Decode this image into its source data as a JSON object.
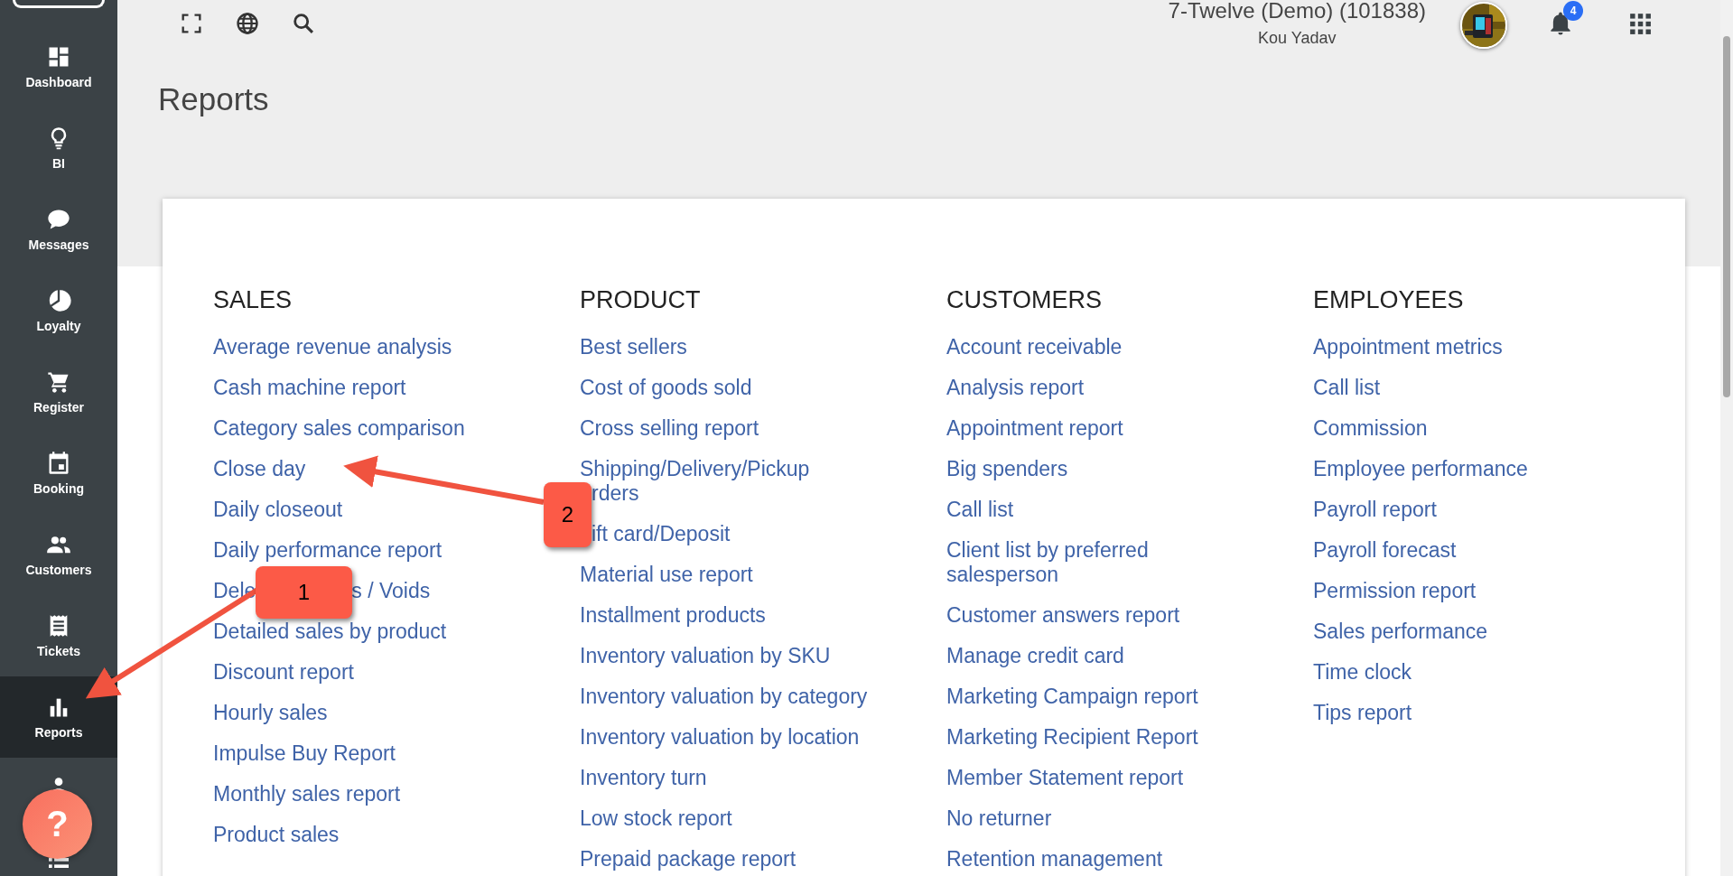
{
  "sidebar": {
    "items": [
      {
        "label": "Dashboard",
        "selected": false
      },
      {
        "label": "BI",
        "selected": false
      },
      {
        "label": "Messages",
        "selected": false
      },
      {
        "label": "Loyalty",
        "selected": false
      },
      {
        "label": "Register",
        "selected": false
      },
      {
        "label": "Booking",
        "selected": false
      },
      {
        "label": "Customers",
        "selected": false
      },
      {
        "label": "Tickets",
        "selected": false
      },
      {
        "label": "Reports",
        "selected": true
      }
    ]
  },
  "account": {
    "store": "7-Twelve (Demo) (101838)",
    "user": "Kou Yadav",
    "notifications": "4"
  },
  "page_title": "Reports",
  "sections": [
    {
      "heading": "SALES",
      "items": [
        {
          "kind": "link",
          "text": "Average revenue analysis"
        },
        {
          "kind": "link",
          "text": "Cash machine report"
        },
        {
          "kind": "link",
          "text": "Category sales comparison"
        },
        {
          "kind": "link",
          "text": "Close day"
        },
        {
          "kind": "link",
          "text": "Daily closeout"
        },
        {
          "kind": "link",
          "text": "Daily performance report"
        },
        {
          "kind": "gap",
          "parts": [
            "Dele",
            "s / Voids"
          ]
        },
        {
          "kind": "link",
          "text": "Detailed sales by product"
        },
        {
          "kind": "link",
          "text": "Discount report"
        },
        {
          "kind": "link",
          "text": "Hourly sales"
        },
        {
          "kind": "link",
          "text": "Impulse Buy Report"
        },
        {
          "kind": "link",
          "text": "Monthly sales report"
        },
        {
          "kind": "link",
          "text": "Product sales"
        }
      ]
    },
    {
      "heading": "PRODUCT",
      "items": [
        {
          "kind": "link",
          "text": "Best sellers"
        },
        {
          "kind": "link",
          "text": "Cost of goods sold"
        },
        {
          "kind": "link",
          "text": "Cross selling report"
        },
        {
          "kind": "lines",
          "lines": [
            {
              "text": "Shipping/Delivery/Pickup"
            },
            {
              "text": "rders",
              "hidden_start": true
            }
          ]
        },
        {
          "kind": "lines",
          "lines": [
            {
              "text": "ift card/Deposit",
              "hidden_start": true
            }
          ]
        },
        {
          "kind": "link",
          "text": "Material use report"
        },
        {
          "kind": "link",
          "text": "Installment products"
        },
        {
          "kind": "link",
          "text": "Inventory valuation by SKU"
        },
        {
          "kind": "link",
          "text": "Inventory valuation by category"
        },
        {
          "kind": "link",
          "text": "Inventory valuation by location"
        },
        {
          "kind": "link",
          "text": "Inventory turn"
        },
        {
          "kind": "link",
          "text": "Low stock report"
        },
        {
          "kind": "link",
          "text": "Prepaid package report"
        }
      ]
    },
    {
      "heading": "CUSTOMERS",
      "items": [
        {
          "kind": "link",
          "text": "Account receivable"
        },
        {
          "kind": "link",
          "text": "Analysis report"
        },
        {
          "kind": "link",
          "text": "Appointment report"
        },
        {
          "kind": "link",
          "text": "Big spenders"
        },
        {
          "kind": "link",
          "text": "Call list"
        },
        {
          "kind": "lines",
          "lines": [
            {
              "text": "Client list by preferred"
            },
            {
              "text": "salesperson"
            }
          ]
        },
        {
          "kind": "link",
          "text": "Customer answers report"
        },
        {
          "kind": "link",
          "text": "Manage credit card"
        },
        {
          "kind": "link",
          "text": "Marketing Campaign report"
        },
        {
          "kind": "link",
          "text": "Marketing Recipient Report"
        },
        {
          "kind": "link",
          "text": "Member Statement report"
        },
        {
          "kind": "link",
          "text": "No returner"
        },
        {
          "kind": "link",
          "text": "Retention management"
        }
      ]
    },
    {
      "heading": "EMPLOYEES",
      "items": [
        {
          "kind": "link",
          "text": "Appointment metrics"
        },
        {
          "kind": "link",
          "text": "Call list"
        },
        {
          "kind": "link",
          "text": "Commission"
        },
        {
          "kind": "link",
          "text": "Employee performance"
        },
        {
          "kind": "link",
          "text": "Payroll report"
        },
        {
          "kind": "link",
          "text": "Payroll forecast"
        },
        {
          "kind": "link",
          "text": "Permission report"
        },
        {
          "kind": "link",
          "text": "Sales performance"
        },
        {
          "kind": "link",
          "text": "Time clock"
        },
        {
          "kind": "link",
          "text": "Tips report"
        }
      ]
    }
  ],
  "annotations": [
    {
      "label": "1"
    },
    {
      "label": "2"
    }
  ],
  "help_button": {
    "label": "?"
  }
}
